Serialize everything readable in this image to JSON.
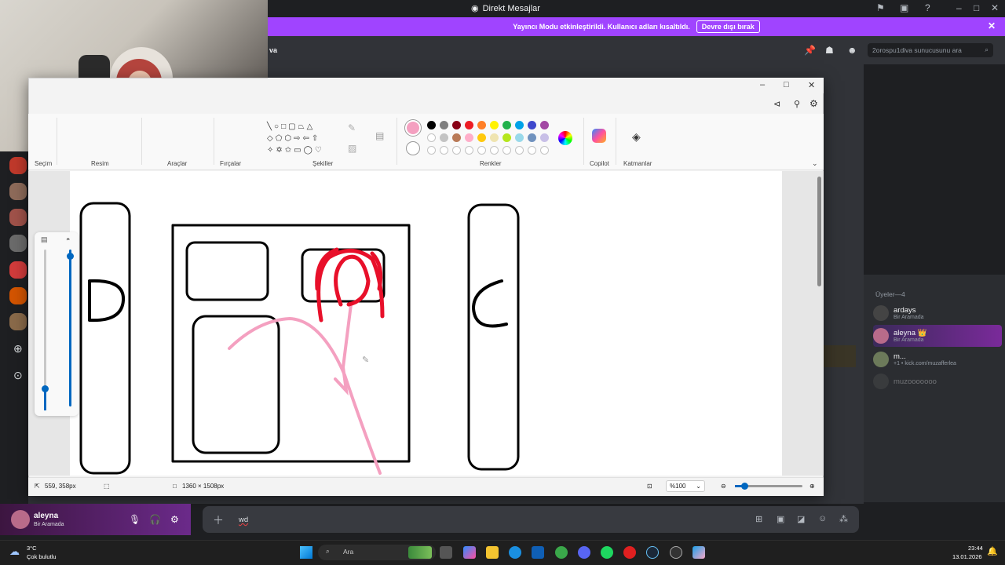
{
  "discord": {
    "window_title": "Direkt Mesajlar",
    "streamer_banner": {
      "text": "Yayıncı Modu etkinleştirildi. Kullanıcı adları kısaltıldı.",
      "button": "Devre dışı bırak"
    },
    "channel_name": "va",
    "search_placeholder": "2orospu1diva sunucusunu ara",
    "members_header": "Üyeler—4",
    "members": [
      {
        "name": "ardays",
        "status": "Bir Aramada"
      },
      {
        "name": "aleyna 👑",
        "status": "Bir Aramada"
      },
      {
        "name": "m...",
        "status": "+1 • kick.com/muzafferlea"
      },
      {
        "name": "muzooooooo",
        "status": ""
      }
    ],
    "user_panel": {
      "name": "aleyna",
      "status": "Bir Aramada"
    },
    "message_input": "wd"
  },
  "paint": {
    "ribbon_groups": [
      "Seçim",
      "Resim",
      "Araçlar",
      "Fırçalar",
      "Şekiller",
      "Renkler",
      "Copilot",
      "Katmanlar"
    ],
    "palette_row1": [
      "#000000",
      "#7f7f7f",
      "#880015",
      "#ed1c24",
      "#ff7f27",
      "#fff200",
      "#22b14c",
      "#00a2e8",
      "#3f48cc",
      "#a349a4"
    ],
    "palette_row2": [
      "#ffffff",
      "#c3c3c3",
      "#b97a57",
      "#ffaec9",
      "#ffc90e",
      "#efe4b0",
      "#b5e61d",
      "#99d9ea",
      "#7092be",
      "#c8bfe7"
    ],
    "current_color": "#f4a0c0",
    "status": {
      "cursor_position": "559, 358px",
      "canvas_size": "1360 × 1508px",
      "zoom": "%100"
    },
    "canvas_letters": [
      "D",
      "C"
    ]
  },
  "taskbar": {
    "weather_temp": "3°C",
    "weather_desc": "Çok bulutlu",
    "search_placeholder": "Ara",
    "time": "23:44",
    "date": "13.01.2026"
  }
}
